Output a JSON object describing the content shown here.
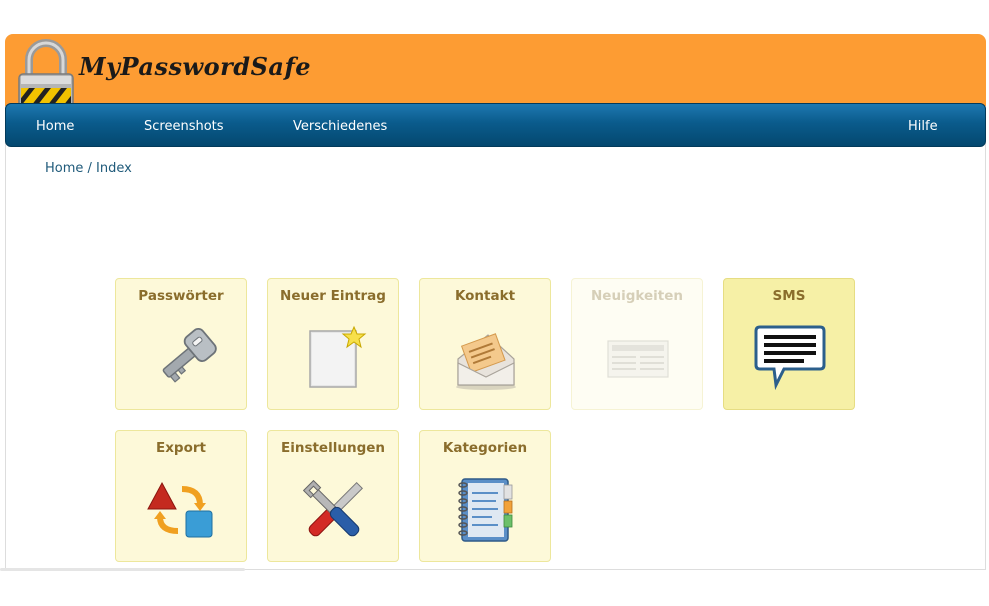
{
  "app": {
    "title": "MyPasswordSafe"
  },
  "nav": {
    "items": [
      {
        "label": "Home"
      },
      {
        "label": "Screenshots"
      },
      {
        "label": "Verschiedenes"
      }
    ],
    "help_label": "Hilfe"
  },
  "breadcrumb": {
    "home": "Home",
    "separator": " / ",
    "current": "Index"
  },
  "tiles": [
    {
      "label": "Passwörter",
      "icon": "key-icon",
      "state": "normal"
    },
    {
      "label": "Neuer Eintrag",
      "icon": "new-document-icon",
      "state": "normal"
    },
    {
      "label": "Kontakt",
      "icon": "envelope-icon",
      "state": "normal"
    },
    {
      "label": "Neuigkeiten",
      "icon": "newspaper-icon",
      "state": "disabled"
    },
    {
      "label": "SMS",
      "icon": "speech-bubble-icon",
      "state": "highlighted"
    },
    {
      "label": "Export",
      "icon": "shapes-convert-icon",
      "state": "normal"
    },
    {
      "label": "Einstellungen",
      "icon": "tools-icon",
      "state": "normal"
    },
    {
      "label": "Kategorien",
      "icon": "address-book-icon",
      "state": "normal"
    }
  ],
  "colors": {
    "header_orange": "#fd9c33",
    "nav_blue": "#0a5b8c",
    "tile_bg": "#fdf9d9",
    "tile_label": "#8a6d2c"
  }
}
